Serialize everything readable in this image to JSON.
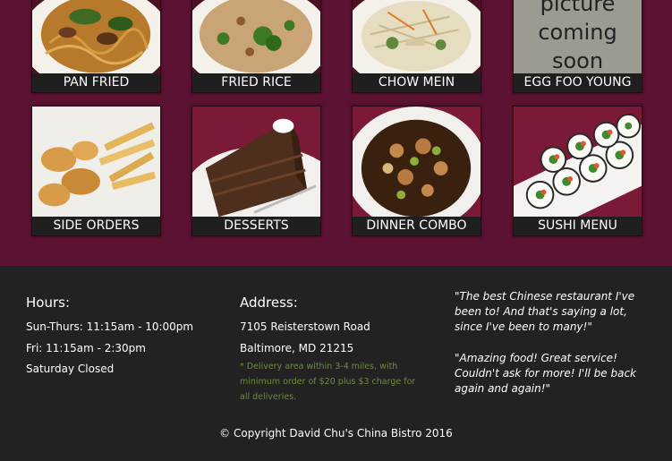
{
  "menu": {
    "tiles": [
      {
        "label": "PAN FRIED NOODLES"
      },
      {
        "label": "FRIED RICE"
      },
      {
        "label": "CHOW MEIN"
      },
      {
        "label": "EGG FOO YOUNG",
        "placeholder": [
          "picture",
          "coming",
          "soon"
        ]
      },
      {
        "label": "SIDE ORDERS"
      },
      {
        "label": "DESSERTS"
      },
      {
        "label": "DINNER COMBO"
      },
      {
        "label": "SUSHI MENU"
      }
    ]
  },
  "footer": {
    "hours": {
      "title": "Hours:",
      "lines": [
        "Sun-Thurs: 11:15am - 10:00pm",
        "Fri: 11:15am - 2:30pm",
        "Saturday Closed"
      ]
    },
    "address": {
      "title": "Address:",
      "street": "7105 Reisterstown Road",
      "city": "Baltimore, MD 21215",
      "note": "* Delivery area within 3-4 miles, with minimum order of $20 plus $3 charge for all deliveries."
    },
    "testimonials": [
      "\"The best Chinese restaurant I've been to! And that's saying a lot, since I've been to many!\"",
      "\"Amazing food! Great service! Couldn't ask for more! I'll be back again and again!\""
    ],
    "copyright": "© Copyright David Chu's China Bistro 2016"
  },
  "colors": {
    "menu_background": "#5c1232",
    "footer_background": "#222222",
    "label_background": "#1f1f1f",
    "note_text": "#6a8d3c"
  }
}
